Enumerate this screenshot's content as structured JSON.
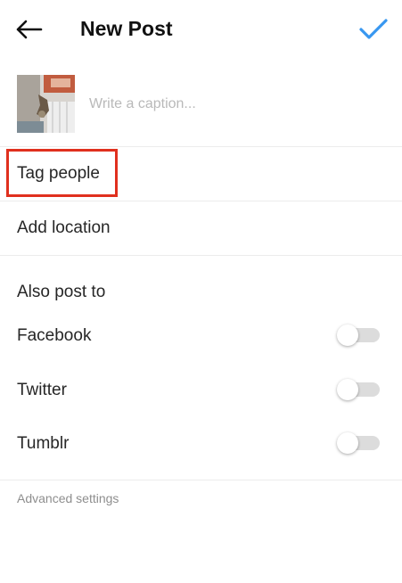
{
  "header": {
    "title": "New Post",
    "back_icon": "arrow-left-icon",
    "confirm_icon": "checkmark-icon",
    "accent_color": "#3897f0"
  },
  "composer": {
    "caption_placeholder": "Write a caption...",
    "caption_value": "",
    "thumbnail_icon": "photo-thumbnail"
  },
  "options": {
    "tag_people": "Tag people",
    "add_location": "Add location"
  },
  "share": {
    "section_title": "Also post to",
    "items": [
      {
        "label": "Facebook",
        "enabled": false
      },
      {
        "label": "Twitter",
        "enabled": false
      },
      {
        "label": "Tumblr",
        "enabled": false
      }
    ]
  },
  "footer": {
    "advanced_settings": "Advanced settings"
  },
  "annotation": {
    "highlight_color": "#e0301e"
  }
}
